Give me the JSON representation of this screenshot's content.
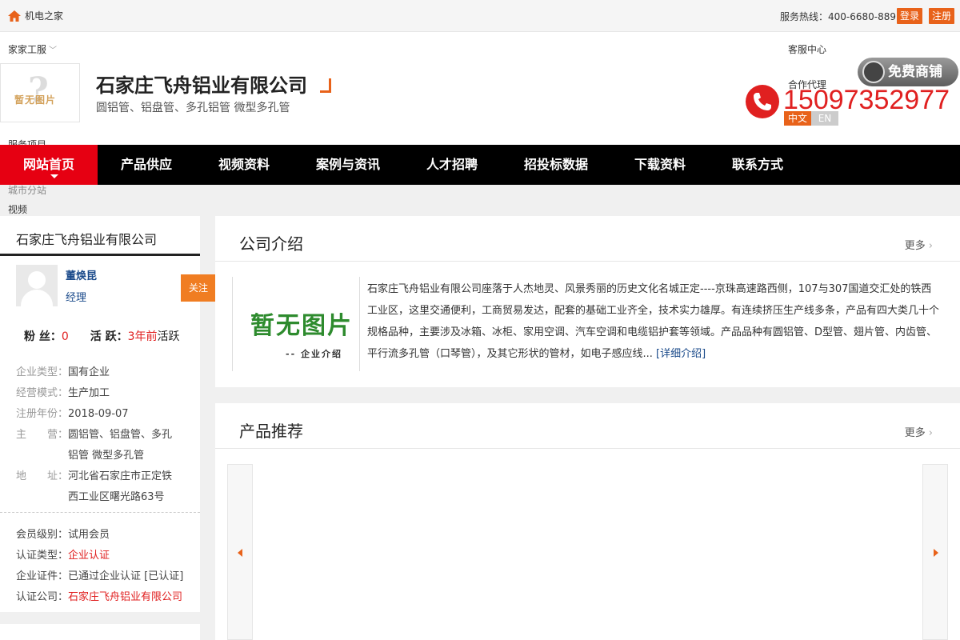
{
  "topbar": {
    "site_name": "机电之家",
    "hotline": "服务热线：400-6680-889",
    "login": "登录",
    "register": "注册"
  },
  "header": {
    "stray_top_left": "家家工服",
    "stray_top_right": "客服中心",
    "stray_mid_right": "合作代理",
    "logo_placeholder_text": "暂无图片",
    "company_name": "石家庄飞舟铝业有限公司",
    "company_sub": "圆铝管、铝盘管、多孔铝管 微型多孔管",
    "phone": "15097352977",
    "free_shop": "免费商铺",
    "lang_cn": "中文",
    "lang_en": "EN",
    "stray_bottom_left": "服务项目"
  },
  "nav": {
    "items": [
      "网站首页",
      "产品供应",
      "视频资料",
      "案例与资讯",
      "人才招聘",
      "招投标数据",
      "下载资料",
      "联系方式"
    ],
    "overlay": "城市分站"
  },
  "stray_video": "视频",
  "sidebar": {
    "title": "石家庄飞舟铝业有限公司",
    "person_name": "董焕昆",
    "person_role": "经理",
    "follow": "关注",
    "fans_label": "粉 丝：",
    "fans_value": "0",
    "active_label": "活 跃：",
    "active_value": "3年前",
    "active_suffix": "活跃",
    "info": [
      {
        "label": "企业类型：",
        "value": "国有企业"
      },
      {
        "label": "经营模式：",
        "value": "生产加工"
      },
      {
        "label": "注册年份：",
        "value": "2018-09-07"
      },
      {
        "label": "主　　营：",
        "value": "圆铝管、铝盘管、多孔"
      },
      {
        "label": "",
        "value": "铝管 微型多孔管"
      },
      {
        "label": "地　　址：",
        "value": "河北省石家庄市正定铁"
      },
      {
        "label": "",
        "value": "西工业区曙光路63号"
      }
    ],
    "member": [
      {
        "label": "会员级别：",
        "value": "试用会员",
        "red": false
      },
      {
        "label": "认证类型：",
        "value": "企业认证",
        "red": true
      },
      {
        "label": "企业证件：",
        "value": "已通过企业认证 [已认证]",
        "red": false
      },
      {
        "label": "认证公司：",
        "value": "石家庄飞舟铝业有限公司",
        "red": true
      }
    ]
  },
  "intro": {
    "title": "公司介绍",
    "more": "更多",
    "image_text": "暂无图片",
    "image_sub": "-- 企业介绍",
    "text": "石家庄飞舟铝业有限公司座落于人杰地灵、风景秀丽的历史文化名城正定----京珠高速路西侧，107与307国道交汇处的铁西工业区，这里交通便利，工商贸易发达，配套的基础工业齐全，技术实力雄厚。有连续挤压生产线多条，产品有四大类几十个规格品种，主要涉及冰箱、冰柜、家用空调、汽车空调和电缆铝护套等领域。产品品种有圆铝管、D型管、翅片管、内齿管、平行流多孔管（口琴管），及其它形状的管材，如电子感应线...",
    "detail_link": "[详细介绍]"
  },
  "products": {
    "title": "产品推荐",
    "more": "更多"
  },
  "colors": {
    "accent_orange": "#e8621a",
    "nav_active_red": "#e60012",
    "phone_red": "#e02020",
    "link_blue": "#1a4a8a"
  }
}
